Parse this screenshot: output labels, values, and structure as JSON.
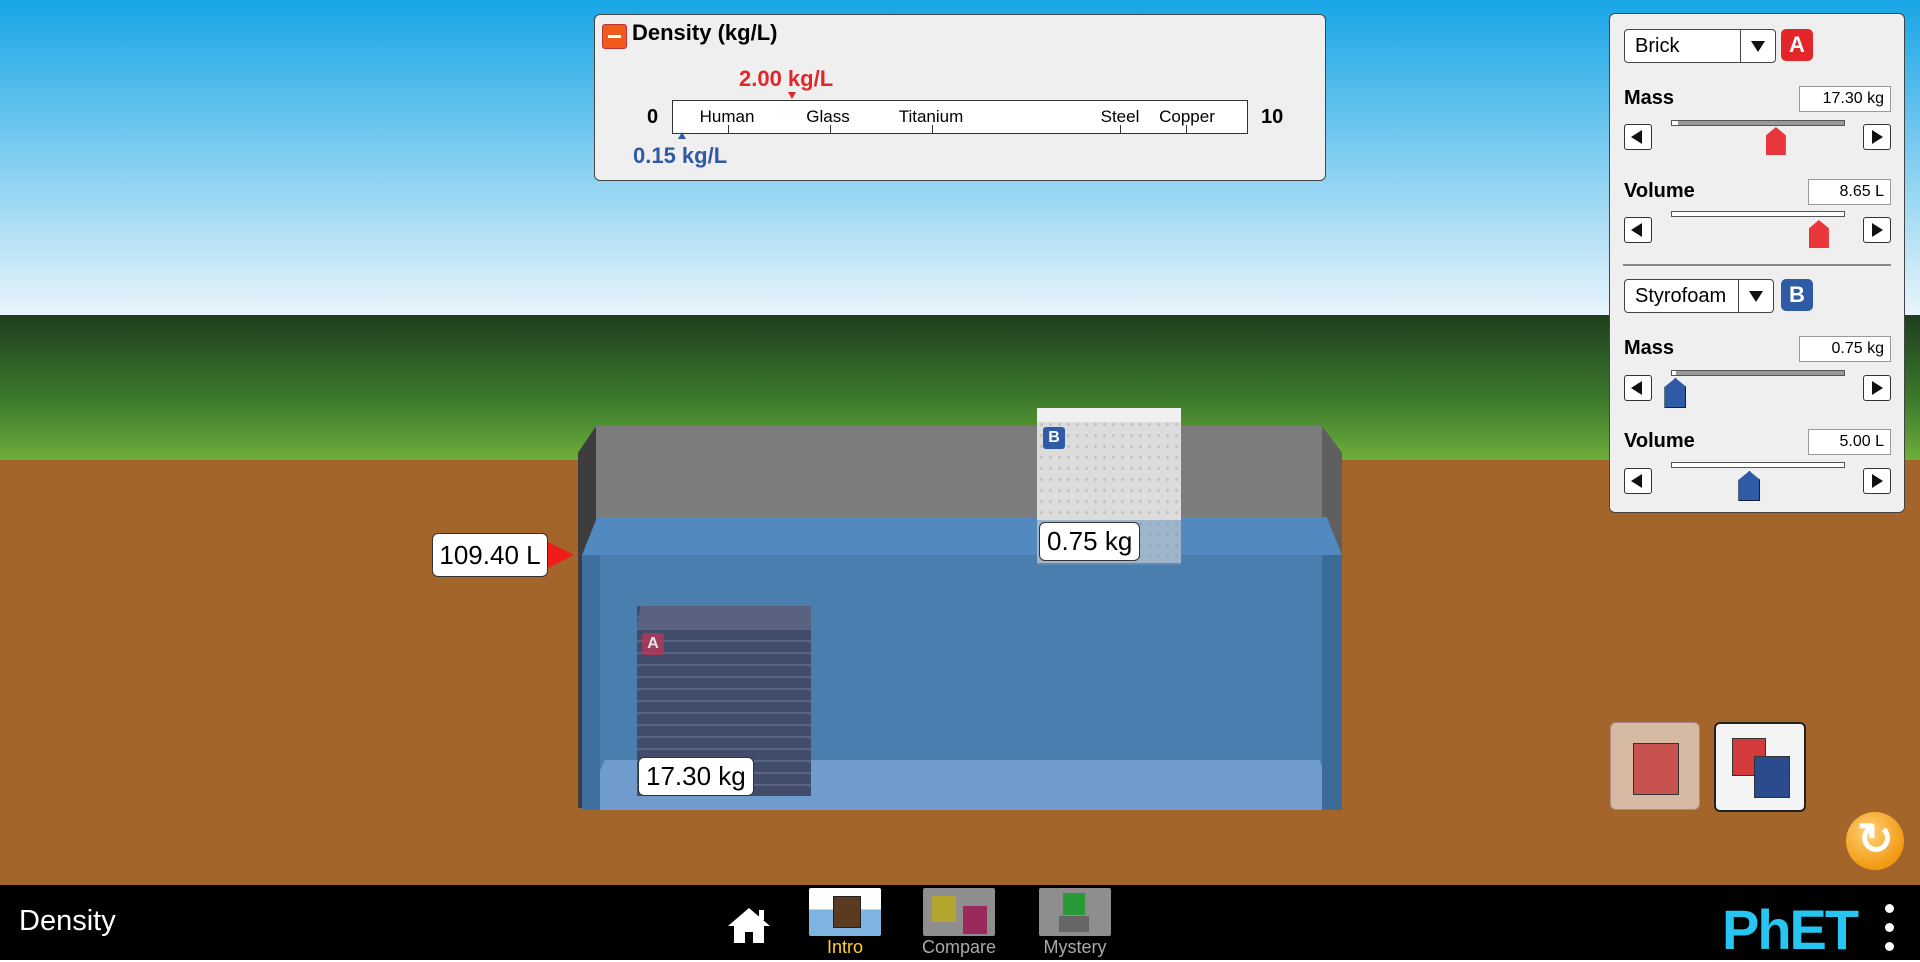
{
  "app": {
    "title": "Density"
  },
  "density_panel": {
    "title": "Density (kg/L)",
    "scale_min": "0",
    "scale_max": "10",
    "materials": [
      "Human",
      "Glass",
      "Titanium",
      "Steel",
      "Copper"
    ],
    "readout_a": "2.00 kg/L",
    "readout_b": "0.15 kg/L",
    "accent_a": "#e3262a",
    "accent_b": "#2e5aa6"
  },
  "scene": {
    "volume_readout": "109.40 L",
    "block_a": {
      "letter": "A",
      "mass_label": "17.30 kg"
    },
    "block_b": {
      "letter": "B",
      "mass_label": "0.75 kg"
    }
  },
  "controls": {
    "block_a": {
      "material": "Brick",
      "badge": "A",
      "mass_label": "Mass",
      "mass_value": "17.30 kg",
      "mass_fraction": 0.61,
      "volume_label": "Volume",
      "volume_value": "8.65 L",
      "volume_fraction": 0.86
    },
    "block_b": {
      "material": "Styrofoam",
      "badge": "B",
      "mass_label": "Mass",
      "mass_value": "0.75 kg",
      "mass_fraction": 0.02,
      "volume_label": "Volume",
      "volume_value": "5.00 L",
      "volume_fraction": 0.45
    }
  },
  "nav": {
    "tabs": [
      {
        "label": "Intro",
        "selected": true
      },
      {
        "label": "Compare",
        "selected": false
      },
      {
        "label": "Mystery",
        "selected": false
      }
    ],
    "logo": "PhET"
  },
  "icons": [
    "home-icon",
    "collapse-icon",
    "reset-icon",
    "menu-dots-icon",
    "dropdown-arrow-icon",
    "left-arrow-icon",
    "right-arrow-icon"
  ]
}
